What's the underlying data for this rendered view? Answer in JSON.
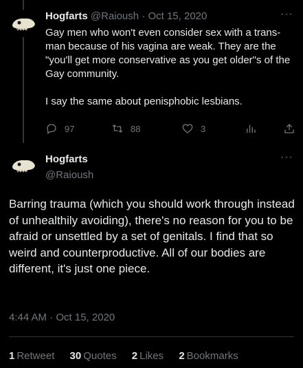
{
  "tweet1": {
    "name": "Hogfarts",
    "handle": "@Raioush",
    "separator": "·",
    "date": "Oct 15, 2020",
    "text": "Gay men who won't even consider sex with a trans-man because of his vagina are weak. They are the \"you'll get more conservative as you get older\"s of the Gay community.\n\nI say the same about penisphobic lesbians.",
    "actions": {
      "replies": "97",
      "retweets": "88",
      "likes": "3"
    },
    "more": "···"
  },
  "tweet2": {
    "name": "Hogfarts",
    "handle": "@Raioush",
    "more": "···",
    "text": "Barring trauma (which you should work through instead of unhealthily avoiding), there's no reason for you to be afraid or unsettled by a set of genitals. I find that so weird and counterproductive. All of our bodies are different, it's just one piece.",
    "timestamp": "4:44 AM · Oct 15, 2020",
    "stats": [
      {
        "count": "1",
        "label": "Retweet"
      },
      {
        "count": "30",
        "label": "Quotes"
      },
      {
        "count": "2",
        "label": "Likes"
      },
      {
        "count": "2",
        "label": "Bookmarks"
      }
    ]
  },
  "colors": {
    "background": "#000000",
    "text": "#e7e9ea",
    "muted": "#71767b",
    "divider": "#2f3336"
  }
}
